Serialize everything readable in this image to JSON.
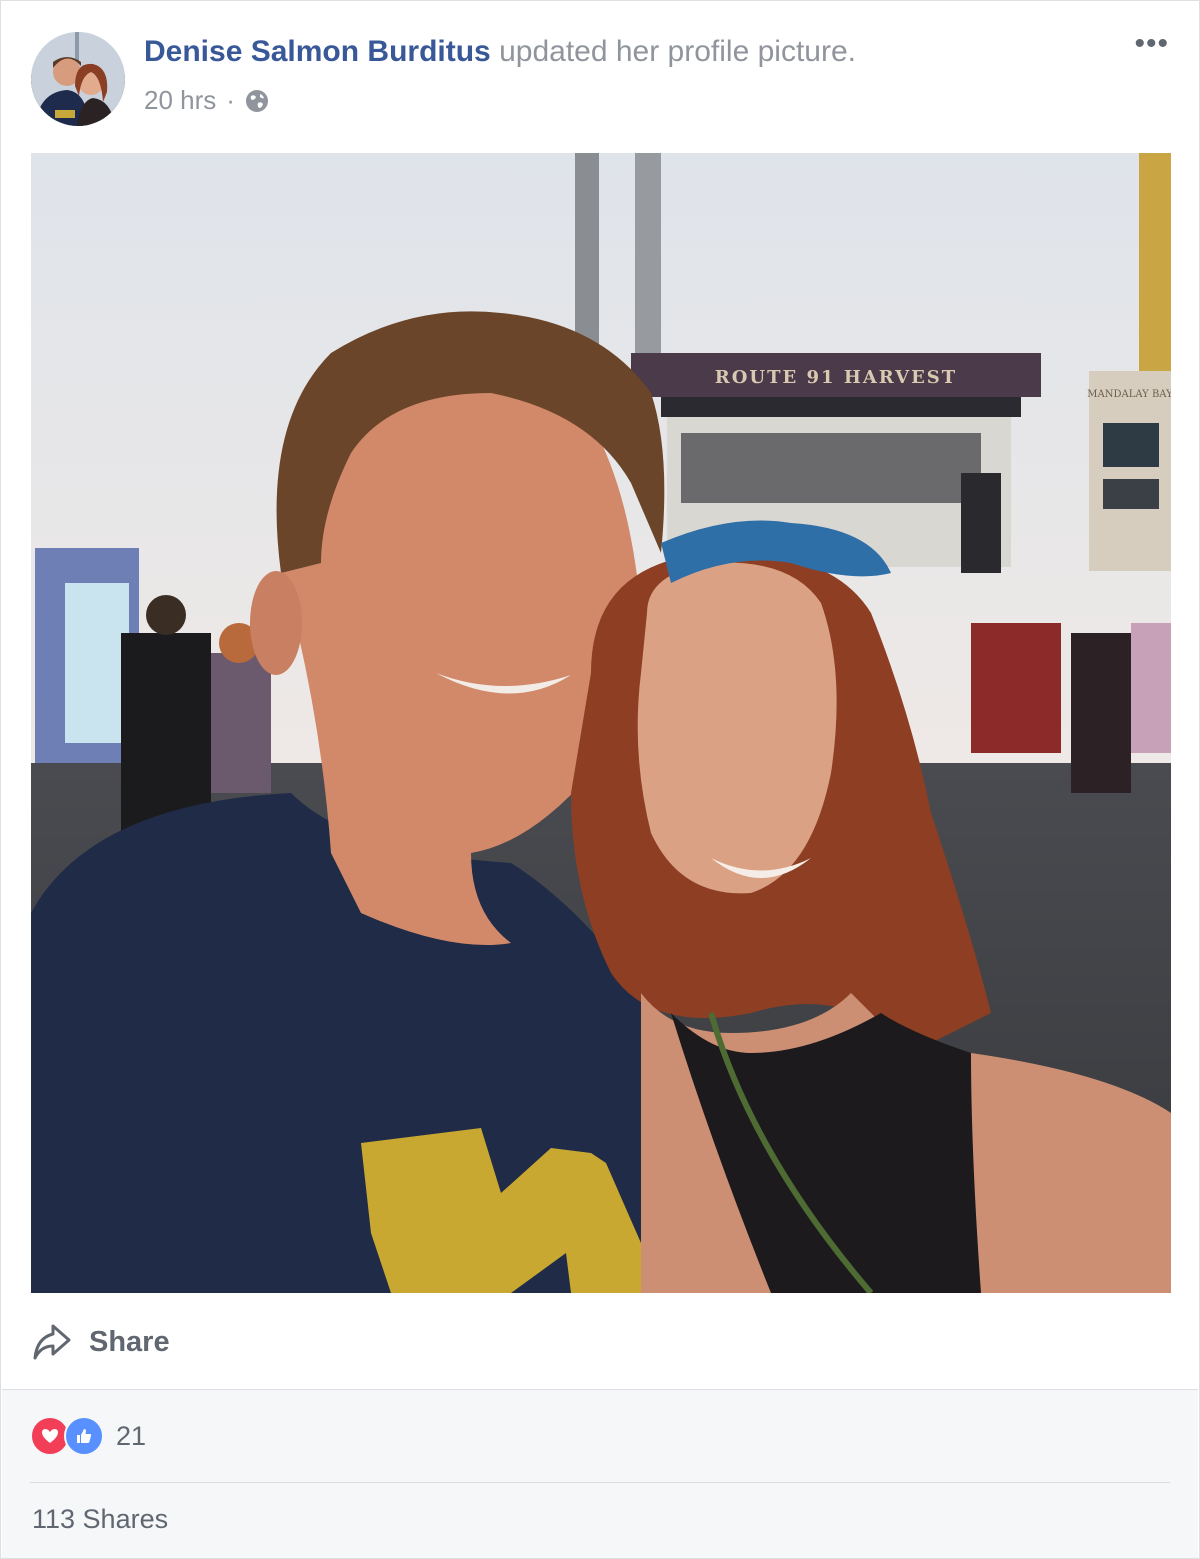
{
  "post": {
    "author": "Denise Salmon Burditus",
    "action": "updated her profile picture.",
    "time": "20 hrs",
    "separator": "·",
    "privacy_icon": "globe-icon",
    "more_label": "•••"
  },
  "photo": {
    "sign_text": "ROUTE 91 HARVEST",
    "building_sign": "MANDALAY BAY"
  },
  "actions": {
    "share_label": "Share",
    "share_icon": "share-arrow-icon"
  },
  "footer": {
    "reaction_icons": [
      "love-icon",
      "like-icon"
    ],
    "reaction_count": "21",
    "shares_label": "113 Shares"
  },
  "colors": {
    "author_link": "#385898",
    "love": "#f33e58",
    "like": "#5890ff",
    "muted_text": "#90949c"
  }
}
